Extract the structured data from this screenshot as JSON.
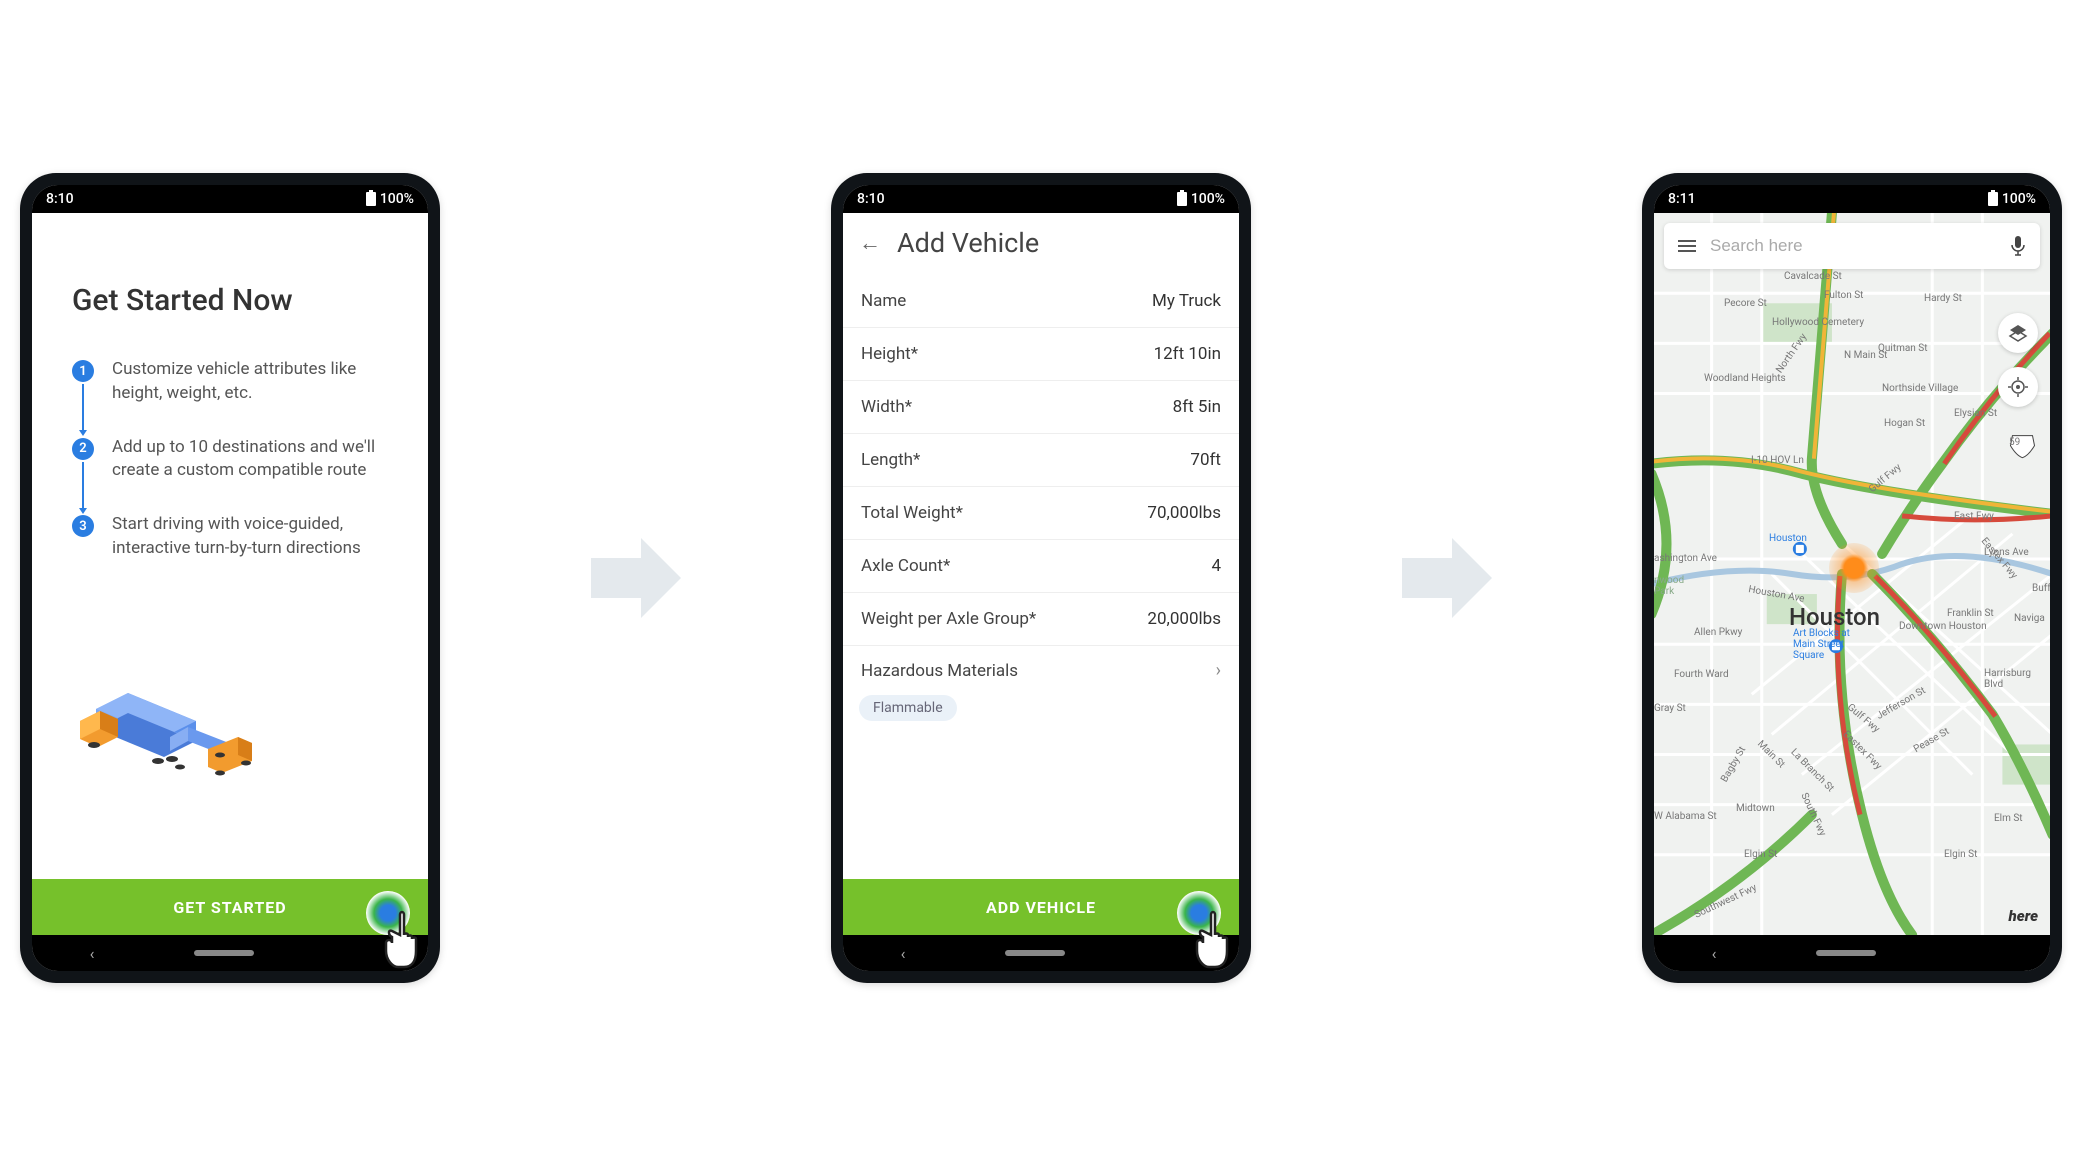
{
  "screen1": {
    "status_time": "8:10",
    "status_batt": "100%",
    "title": "Get Started Now",
    "steps": [
      "Customize vehicle attributes like height, weight, etc.",
      "Add up to 10 destinations and we'll create a custom compatible route",
      "Start driving with voice-guided, interactive turn-by-turn directions"
    ],
    "cta": "GET STARTED"
  },
  "screen2": {
    "status_time": "8:10",
    "status_batt": "100%",
    "title": "Add Vehicle",
    "rows": [
      {
        "label": "Name",
        "value": "My Truck"
      },
      {
        "label": "Height*",
        "value": "12ft 10in"
      },
      {
        "label": "Width*",
        "value": "8ft 5in"
      },
      {
        "label": "Length*",
        "value": "70ft"
      },
      {
        "label": "Total Weight*",
        "value": "70,000lbs"
      },
      {
        "label": "Axle Count*",
        "value": "4"
      },
      {
        "label": "Weight per Axle Group*",
        "value": "20,000lbs"
      }
    ],
    "haz_label": "Hazardous Materials",
    "haz_tag": "Flammable",
    "cta": "ADD VEHICLE"
  },
  "screen3": {
    "status_time": "8:11",
    "status_batt": "100%",
    "search_placeholder": "Search here",
    "main_city": "Houston",
    "labels": {
      "hollywood_cemetery": "Hollywood Cemetery",
      "woodland_heights": "Woodland Heights",
      "northside_village": "Northside Village",
      "downtown_houston": "Downtown Houston",
      "midtown": "Midtown",
      "fourth_ward": "Fourth Ward",
      "pecore": "Pecore St",
      "cavalcade": "Cavalcade St",
      "main_n": "N Main St",
      "i10hov": "I-10 HOV Ln",
      "washington": "ashington Ave",
      "allen_pkwy": "Allen Pkwy",
      "gray": "Gray St",
      "alabama": "W Alabama St",
      "elm": "Elm St",
      "franklin": "Franklin St",
      "jefferson": "Jefferson St",
      "pease": "Pease St",
      "elgin": "Elgin St",
      "gulf": "Gulf Fwy",
      "eastex": "Eastex Fwy",
      "east_fwy": "East Fwy",
      "harrisburg": "Harrisburg Blvd",
      "hardy": "Hardy St",
      "fulton": "Fulton St",
      "hogan": "Hogan St",
      "elysian": "Elysian St",
      "quitman": "Quitman St",
      "north_fwy": "North Fwy",
      "southwest": "Southwest Fwy",
      "labranch": "La Branch St",
      "navigation": "Naviga",
      "lyons": "Lyons Ave",
      "buffalo": "Buff",
      "art_blocks_1": "Art Blocks at",
      "art_blocks_2": "Main Street",
      "art_blocks_3": "Square",
      "i59": "59",
      "houston_stop": "Houston"
    },
    "attribution": "here"
  }
}
